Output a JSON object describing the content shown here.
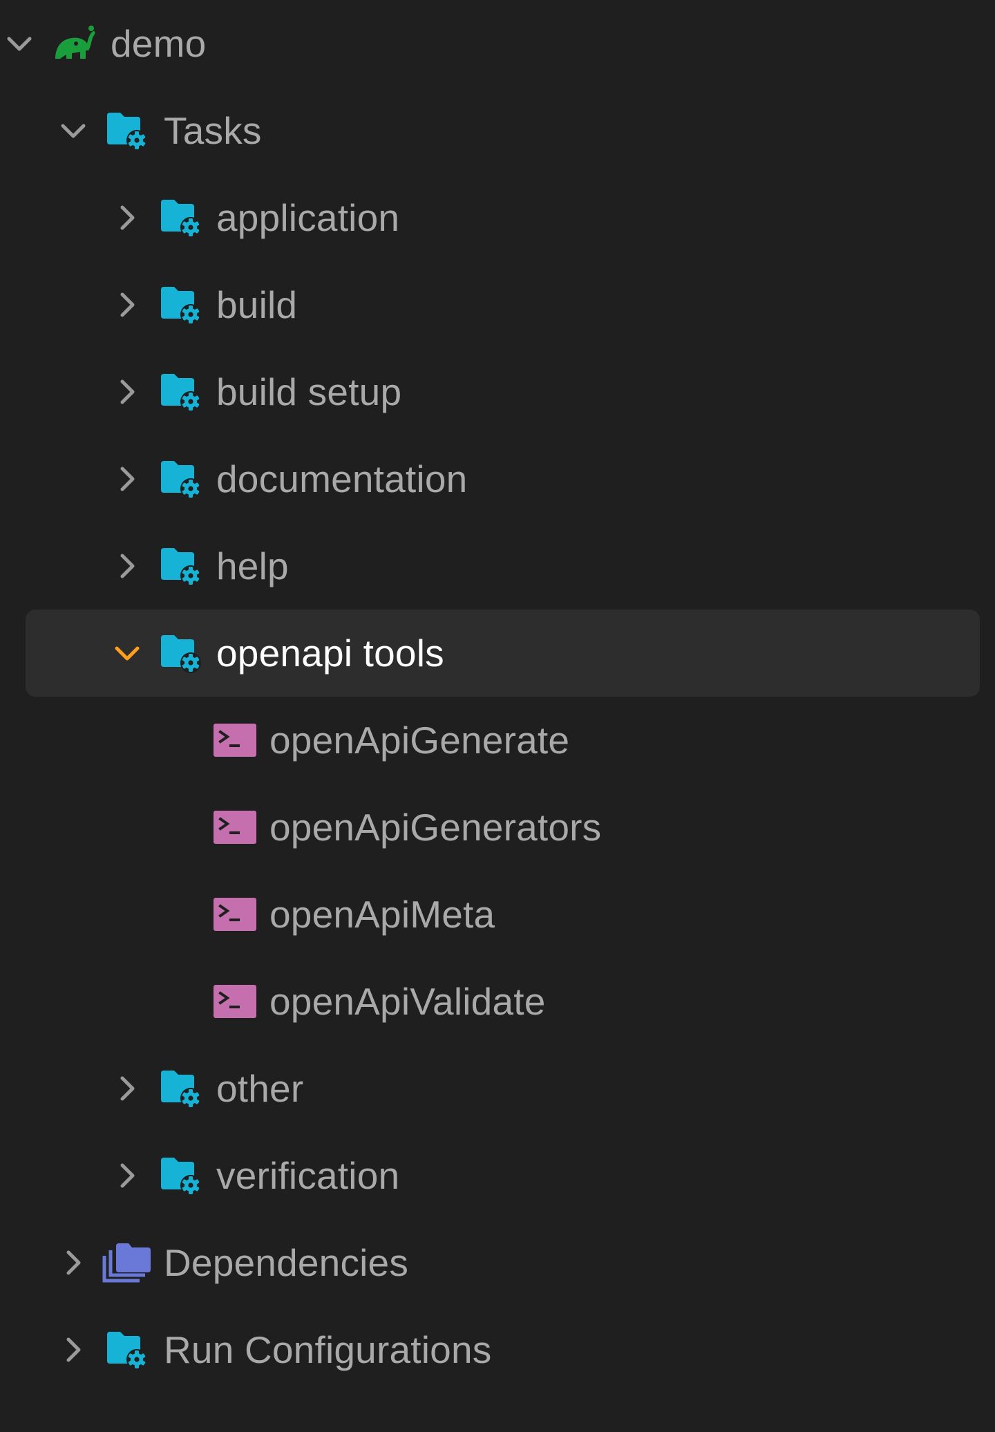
{
  "tree": {
    "root": {
      "label": "demo",
      "icon": "gradle-elephant-icon",
      "expanded": true
    },
    "tasks": {
      "label": "Tasks",
      "icon": "folder-gear-icon",
      "expanded": true
    },
    "task_groups": [
      {
        "label": "application",
        "expanded": false
      },
      {
        "label": "build",
        "expanded": false
      },
      {
        "label": "build setup",
        "expanded": false
      },
      {
        "label": "documentation",
        "expanded": false
      },
      {
        "label": "help",
        "expanded": false
      },
      {
        "label": "openapi tools",
        "expanded": true,
        "selected": true
      },
      {
        "label": "other",
        "expanded": false
      },
      {
        "label": "verification",
        "expanded": false
      }
    ],
    "openapi_tasks": [
      {
        "label": "openApiGenerate",
        "icon": "terminal-icon"
      },
      {
        "label": "openApiGenerators",
        "icon": "terminal-icon"
      },
      {
        "label": "openApiMeta",
        "icon": "terminal-icon"
      },
      {
        "label": "openApiValidate",
        "icon": "terminal-icon"
      }
    ],
    "dependencies": {
      "label": "Dependencies",
      "icon": "folders-icon",
      "expanded": false
    },
    "run_configurations": {
      "label": "Run Configurations",
      "icon": "folder-gear-icon",
      "expanded": false
    }
  },
  "colors": {
    "background": "#1f1f1f",
    "selection": "#2d2d2d",
    "text": "#a9a9a9",
    "text_selected": "#ffffff",
    "chevron": "#9a9a9a",
    "chevron_selected": "#ff9f1c",
    "folder": "#17b3d6",
    "gradle": "#1a9e3c",
    "terminal": "#c56fae",
    "dependencies_folder": "#6a79d8"
  }
}
